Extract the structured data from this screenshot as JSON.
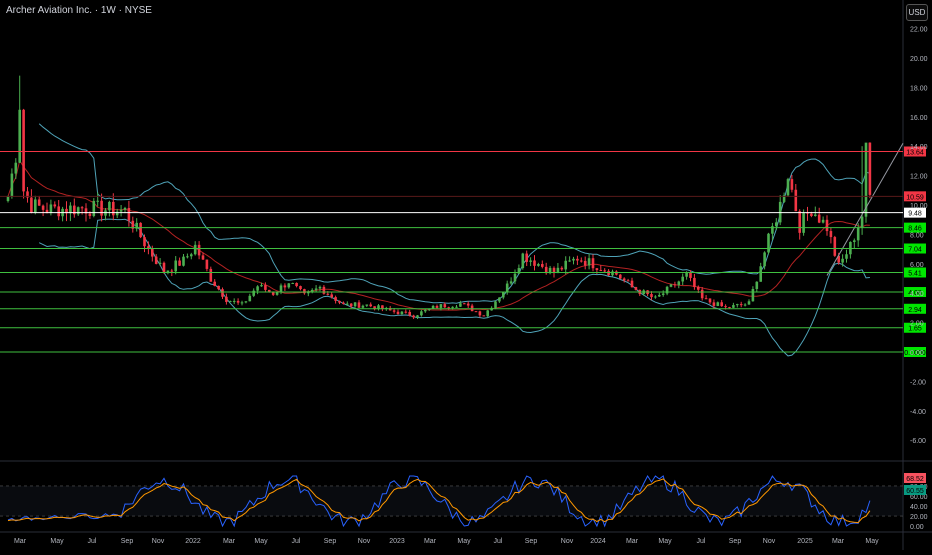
{
  "header": {
    "title": "Archer Aviation Inc. · 1W · NYSE",
    "currency": "USD"
  },
  "price_axis": {
    "labels": [
      "22.00",
      "20.00",
      "18.00",
      "16.00",
      "14.00",
      "12.00",
      "10.00",
      "8.00",
      "6.00",
      "4.00",
      "2.00",
      "0.00",
      "-2.00",
      "-4.00",
      "-6.00"
    ]
  },
  "time_axis": {
    "labels": [
      "Mar",
      "May",
      "Jul",
      "Sep",
      "Nov",
      "2022",
      "Mar",
      "May",
      "Jul",
      "Sep",
      "Nov",
      "2023",
      "Mar",
      "May",
      "Jul",
      "Sep",
      "Nov",
      "2024",
      "Mar",
      "May",
      "Jul",
      "Sep",
      "Nov",
      "2025",
      "Mar",
      "May"
    ]
  },
  "levels": [
    {
      "value": "13.64",
      "color": "#f23645",
      "line": "#f23645"
    },
    {
      "value": "10.59",
      "color": "#f23645",
      "line": "#5a1a1a"
    },
    {
      "value": "9.48",
      "color": "#ffffff",
      "line": "#ffffff"
    },
    {
      "value": "8.46",
      "color": "#00e600",
      "line": "#3fbf3f"
    },
    {
      "value": "7.04",
      "color": "#00e600",
      "line": "#3fbf3f"
    },
    {
      "value": "5.41",
      "color": "#00e600",
      "line": "#3fbf3f"
    },
    {
      "value": "4.08",
      "color": "#00e600",
      "line": "#3fbf3f"
    },
    {
      "value": "2.94",
      "color": "#00e600",
      "line": "#3fbf3f"
    },
    {
      "value": "1.65",
      "color": "#00e600",
      "line": "#3fbf3f"
    },
    {
      "value": "0.0000",
      "color": "#00e600",
      "line": "#3fbf3f"
    }
  ],
  "oscillator": {
    "axis_labels": [
      "80.00",
      "60.00",
      "40.00",
      "20.00",
      "0.00"
    ],
    "value_1": "68.52",
    "value_2": "60.55",
    "color_1": "#f7525f",
    "color_2": "#089981"
  },
  "colors": {
    "up": "#26a69a",
    "up_candle": "#4caf50",
    "down": "#f23645",
    "bands": "#4fa3b8",
    "ma": "#b22222",
    "osc_fast": "#2962ff",
    "osc_slow": "#ff9800"
  },
  "chart_data": {
    "type": "candlestick",
    "symbol": "Archer Aviation Inc.",
    "interval": "1W",
    "exchange": "NYSE",
    "ylim": [
      -7,
      23
    ],
    "anchors": [
      [
        0,
        10.6
      ],
      [
        2,
        13.5
      ],
      [
        3,
        17.0
      ],
      [
        4,
        11.0
      ],
      [
        6,
        10.0
      ],
      [
        10,
        9.7
      ],
      [
        20,
        9.8
      ],
      [
        30,
        9.6
      ],
      [
        36,
        7.0
      ],
      [
        40,
        5.5
      ],
      [
        45,
        6.2
      ],
      [
        48,
        7.2
      ],
      [
        52,
        5.0
      ],
      [
        56,
        3.6
      ],
      [
        60,
        3.2
      ],
      [
        64,
        4.5
      ],
      [
        68,
        4.0
      ],
      [
        72,
        4.8
      ],
      [
        76,
        3.8
      ],
      [
        80,
        4.4
      ],
      [
        86,
        3.2
      ],
      [
        92,
        3.2
      ],
      [
        98,
        2.8
      ],
      [
        104,
        2.5
      ],
      [
        110,
        3.1
      ],
      [
        116,
        3.3
      ],
      [
        122,
        2.5
      ],
      [
        128,
        4.5
      ],
      [
        132,
        6.6
      ],
      [
        136,
        6.0
      ],
      [
        140,
        5.4
      ],
      [
        146,
        6.4
      ],
      [
        150,
        6.0
      ],
      [
        156,
        5.3
      ],
      [
        160,
        4.4
      ],
      [
        166,
        3.6
      ],
      [
        170,
        4.4
      ],
      [
        174,
        5.2
      ],
      [
        178,
        3.6
      ],
      [
        184,
        3.0
      ],
      [
        190,
        3.3
      ],
      [
        194,
        6.8
      ],
      [
        198,
        10.0
      ],
      [
        200,
        12.2
      ],
      [
        203,
        8.6
      ],
      [
        206,
        9.8
      ],
      [
        210,
        8.5
      ],
      [
        213,
        5.8
      ],
      [
        216,
        7.2
      ],
      [
        219,
        9.3
      ],
      [
        220,
        13.6
      ],
      [
        221,
        10.6
      ]
    ],
    "oscillator": {
      "name": "Stochastic RSI",
      "ylim": [
        0,
        100
      ],
      "levels": [
        80,
        20
      ]
    }
  }
}
